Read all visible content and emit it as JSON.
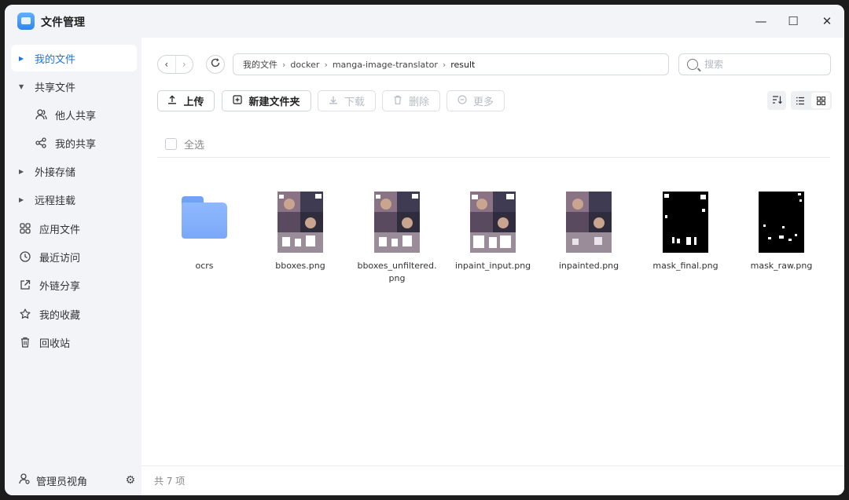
{
  "window": {
    "title": "文件管理"
  },
  "window_controls": {
    "minimize": "—",
    "maximize": "☐",
    "close": "✕"
  },
  "sidebar": {
    "items": [
      {
        "label": "我的文件",
        "active": true
      },
      {
        "label": "共享文件"
      },
      {
        "label": "他人共享"
      },
      {
        "label": "我的共享"
      },
      {
        "label": "外接存储"
      },
      {
        "label": "远程挂载"
      },
      {
        "label": "应用文件"
      },
      {
        "label": "最近访问"
      },
      {
        "label": "外链分享"
      },
      {
        "label": "我的收藏"
      },
      {
        "label": "回收站"
      }
    ],
    "footer_label": "管理员视角"
  },
  "breadcrumb": [
    "我的文件",
    "docker",
    "manga-image-translator",
    "result"
  ],
  "search": {
    "placeholder": "搜索"
  },
  "toolbar": {
    "upload": "上传",
    "new_folder": "新建文件夹",
    "download": "下载",
    "delete": "删除",
    "more": "更多"
  },
  "select_all": "全选",
  "files": [
    {
      "name": "ocrs",
      "type": "folder"
    },
    {
      "name": "bboxes.png",
      "type": "image-color"
    },
    {
      "name": "bboxes_unfiltered.png",
      "type": "image-color"
    },
    {
      "name": "inpaint_input.png",
      "type": "image-color"
    },
    {
      "name": "inpainted.png",
      "type": "image-color"
    },
    {
      "name": "mask_final.png",
      "type": "image-mask"
    },
    {
      "name": "mask_raw.png",
      "type": "image-mask"
    }
  ],
  "status": "共 7 项",
  "colors": {
    "accent": "#1e73e8",
    "sidebar_bg": "#f2f4f8",
    "folder": "#7aa8f8"
  }
}
